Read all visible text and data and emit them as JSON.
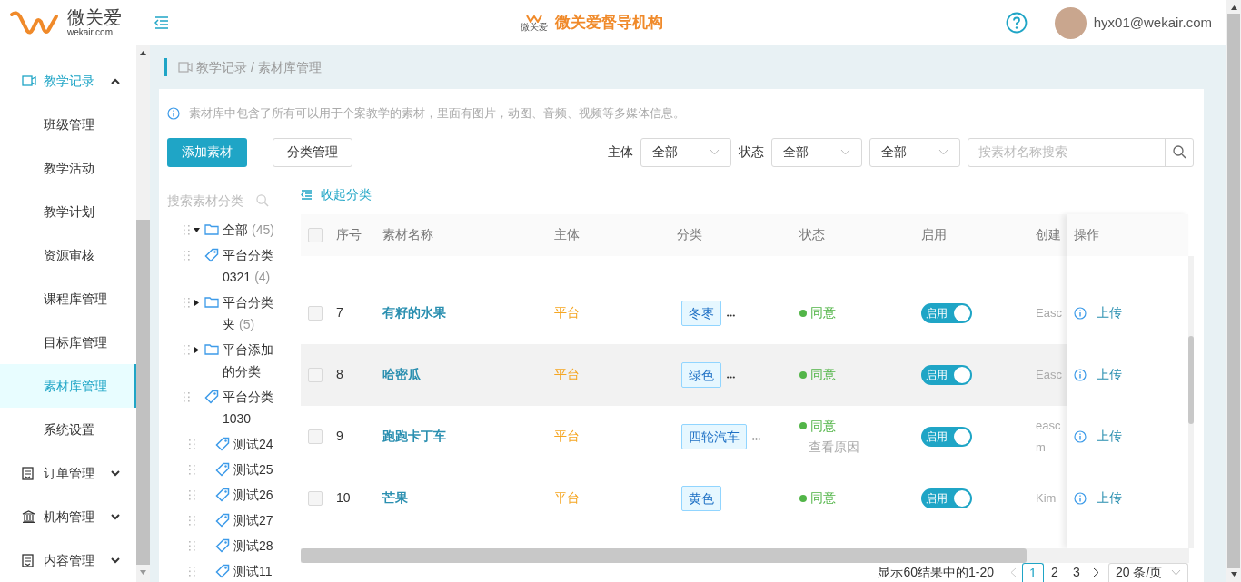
{
  "header": {
    "logo_name": "微关爱",
    "logo_domain": "wekair.com",
    "org_logo_text": "微关爱",
    "org_title": "微关爱督导机构",
    "user": "hyx01@wekair.com"
  },
  "sidebar": {
    "items": [
      {
        "label": "教学记录",
        "expanded": true,
        "children": [
          {
            "label": "班级管理",
            "selected": false
          },
          {
            "label": "教学活动",
            "selected": false
          },
          {
            "label": "教学计划",
            "selected": false
          },
          {
            "label": "资源审核",
            "selected": false
          },
          {
            "label": "课程库管理",
            "selected": false
          },
          {
            "label": "目标库管理",
            "selected": false
          },
          {
            "label": "素材库管理",
            "selected": true
          },
          {
            "label": "系统设置",
            "selected": false
          }
        ]
      },
      {
        "label": "订单管理",
        "expanded": false
      },
      {
        "label": "机构管理",
        "expanded": false
      },
      {
        "label": "内容管理",
        "expanded": false
      }
    ]
  },
  "breadcrumb": "教学记录 / 素材库管理",
  "info": "素材库中包含了所有可以用于个案教学的素材，里面有图片，动图、音频、视频等多媒体信息。",
  "buttons": {
    "add": "添加素材",
    "manage": "分类管理"
  },
  "filters": [
    {
      "label": "主体",
      "value": "全部"
    },
    {
      "label": "状态",
      "value": "全部"
    },
    {
      "value": "全部"
    }
  ],
  "search": {
    "placeholder": "按素材名称搜索"
  },
  "tree": {
    "search_placeholder": "搜索素材分类",
    "items": [
      {
        "kind": "folder",
        "label": "全部",
        "count": "(45)",
        "expanded": true,
        "children": [
          {
            "kind": "tag",
            "label": "平台分类0321",
            "count": "(4)"
          },
          {
            "kind": "folder",
            "label": "平台分类夹",
            "count": "(5)",
            "expanded": false
          },
          {
            "kind": "folder",
            "label": "平台添加的分类",
            "expanded": false
          },
          {
            "kind": "tag",
            "label": "平台分类1030",
            "children": [
              {
                "kind": "tag",
                "label": "测试24"
              },
              {
                "kind": "tag",
                "label": "测试25"
              },
              {
                "kind": "tag",
                "label": "测试26"
              },
              {
                "kind": "tag",
                "label": "测试27"
              },
              {
                "kind": "tag",
                "label": "测试28"
              },
              {
                "kind": "tag",
                "label": "测试11"
              }
            ]
          }
        ]
      }
    ]
  },
  "collapse_link": "收起分类",
  "table": {
    "header_checked": false,
    "columns": [
      "序号",
      "素材名称",
      "主体",
      "分类",
      "状态",
      "启用",
      "创建",
      "操作"
    ],
    "rows": [
      {
        "checked": false,
        "hovered": false,
        "index": "7",
        "name": "有籽的水果",
        "subject": "平台",
        "category": "冬枣",
        "more": true,
        "status": "同意",
        "reason_link": "",
        "enabled": true,
        "toggle_label": "启用",
        "creator": [
          "Easc"
        ],
        "action": "上传"
      },
      {
        "checked": false,
        "hovered": true,
        "index": "8",
        "name": "哈密瓜",
        "subject": "平台",
        "category": "绿色",
        "more": true,
        "status": "同意",
        "reason_link": "",
        "enabled": true,
        "toggle_label": "启用",
        "creator": [
          "Easc"
        ],
        "action": "上传"
      },
      {
        "checked": false,
        "hovered": false,
        "index": "9",
        "name": "跑跑卡丁车",
        "subject": "平台",
        "category": "四轮汽车",
        "more": true,
        "status": "同意",
        "reason_link": "查看原因",
        "enabled": true,
        "toggle_label": "启用",
        "creator": [
          "easc",
          "m"
        ],
        "action": "上传"
      },
      {
        "checked": false,
        "hovered": false,
        "index": "10",
        "name": "芒果",
        "subject": "平台",
        "category": "黄色",
        "more": false,
        "status": "同意",
        "reason_link": "",
        "enabled": true,
        "toggle_label": "启用",
        "creator": [
          "Kim"
        ],
        "action": "上传"
      }
    ]
  },
  "pagination": {
    "summary": "显示60结果中的1-20",
    "pages": [
      {
        "label": "1",
        "selected": true
      },
      {
        "label": "2",
        "selected": false
      },
      {
        "label": "3",
        "selected": false
      }
    ],
    "page_size": "20 条/页"
  }
}
